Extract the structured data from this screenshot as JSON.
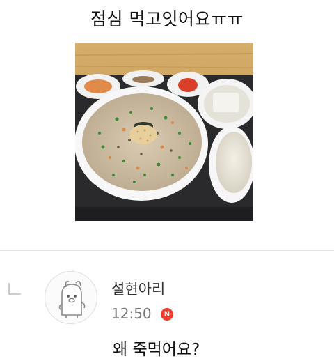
{
  "post": {
    "title": "점심 먹고잇어요ㅠㅠ"
  },
  "comment": {
    "nickname": "설현아리",
    "time": "12:50",
    "new_badge": "N",
    "text": "왜 죽먹어요?"
  },
  "icons": {
    "reply": "reply-arrow-icon",
    "avatar": "default-profile-avatar-icon"
  },
  "colors": {
    "badge": "#ef3d2d",
    "divider": "#e4e4e4",
    "muted_text": "#777777"
  }
}
